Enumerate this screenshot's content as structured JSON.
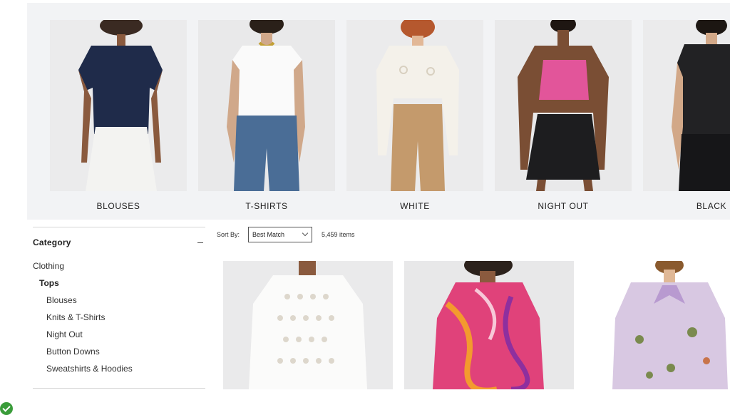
{
  "carousel": {
    "items": [
      {
        "label": "BLOUSES"
      },
      {
        "label": "T-SHIRTS"
      },
      {
        "label": "WHITE"
      },
      {
        "label": "NIGHT OUT"
      },
      {
        "label": "BLACK"
      }
    ]
  },
  "sidebar": {
    "category_title": "Category",
    "items": [
      {
        "label": "Clothing",
        "level": 0
      },
      {
        "label": "Tops",
        "level": 1
      },
      {
        "label": "Blouses",
        "level": 2
      },
      {
        "label": "Knits & T-Shirts",
        "level": 2
      },
      {
        "label": "Night Out",
        "level": 2
      },
      {
        "label": "Button Downs",
        "level": 2
      },
      {
        "label": "Sweatshirts & Hoodies",
        "level": 2
      }
    ]
  },
  "sort": {
    "label": "Sort By:",
    "selected": "Best Match",
    "count": "5,459 items"
  },
  "colors": {
    "carousel_bg": "#f2f3f5",
    "check": "#3a9c3a"
  },
  "icons": [
    "minus-icon",
    "chevron-down-icon",
    "checkmark-icon"
  ]
}
